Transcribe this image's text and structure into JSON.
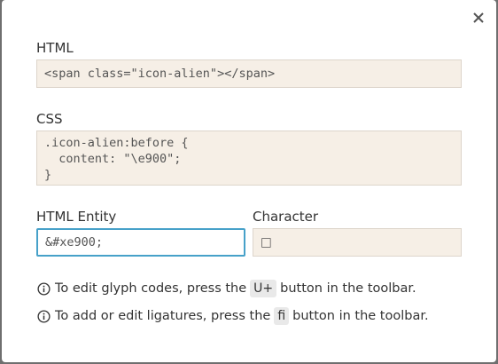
{
  "html_section": {
    "label": "HTML",
    "code": "<span class=\"icon-alien\"></span>"
  },
  "css_section": {
    "label": "CSS",
    "code": ".icon-alien:before {\n  content: \"\\e900\";\n}"
  },
  "entity_section": {
    "label": "HTML Entity",
    "value": "&#xe900;"
  },
  "character_section": {
    "label": "Character",
    "value": "□"
  },
  "tips": [
    {
      "before": "To edit glyph codes, press the",
      "key": "U+",
      "after": "button in the toolbar."
    },
    {
      "before": "To add or edit ligatures, press the",
      "key": "ﬁ",
      "after": "button in the toolbar."
    }
  ],
  "icons": {
    "close": "close-icon",
    "info": "info-icon"
  },
  "colors": {
    "code_bg": "#f6efe6",
    "input_focus": "#47a1c9"
  }
}
